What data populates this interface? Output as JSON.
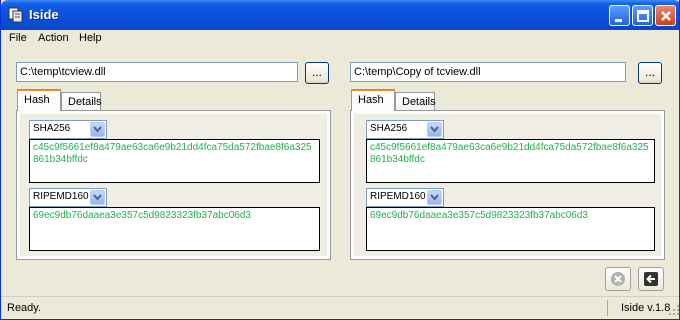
{
  "window": {
    "title": "Iside"
  },
  "menu": [
    "File",
    "Action",
    "Help"
  ],
  "left": {
    "path": "C:\\temp\\tcview.dll",
    "browse_label": "...",
    "tabs": [
      "Hash",
      "Details"
    ],
    "algo1": "SHA256",
    "hash1": "c45c9f5661ef8a479ae63ca6e9b21dd4fca75da572fbae8f6a325861b34bffdc",
    "algo2": "RIPEMD160",
    "hash2": "69ec9db76daaea3e357c5d9823323fb37abc06d3"
  },
  "right": {
    "path": "C:\\temp\\Copy of tcview.dll",
    "browse_label": "...",
    "tabs": [
      "Hash",
      "Details"
    ],
    "algo1": "SHA256",
    "hash1": "c45c9f5661ef8a479ae63ca6e9b21dd4fca75da572fbae8f6a325861b34bffdc",
    "algo2": "RIPEMD160",
    "hash2": "69ec9db76daaea3e357c5d9823323fb37abc06d3"
  },
  "status": {
    "text": "Ready.",
    "version": "Iside v.1.8"
  },
  "colors": {
    "hash_text": "#22b14c",
    "title_bar": "#0a52e0",
    "active_tab_accent": "#e68b2c"
  },
  "icons": {
    "stop": "cancel-icon",
    "exit": "exit-icon"
  }
}
